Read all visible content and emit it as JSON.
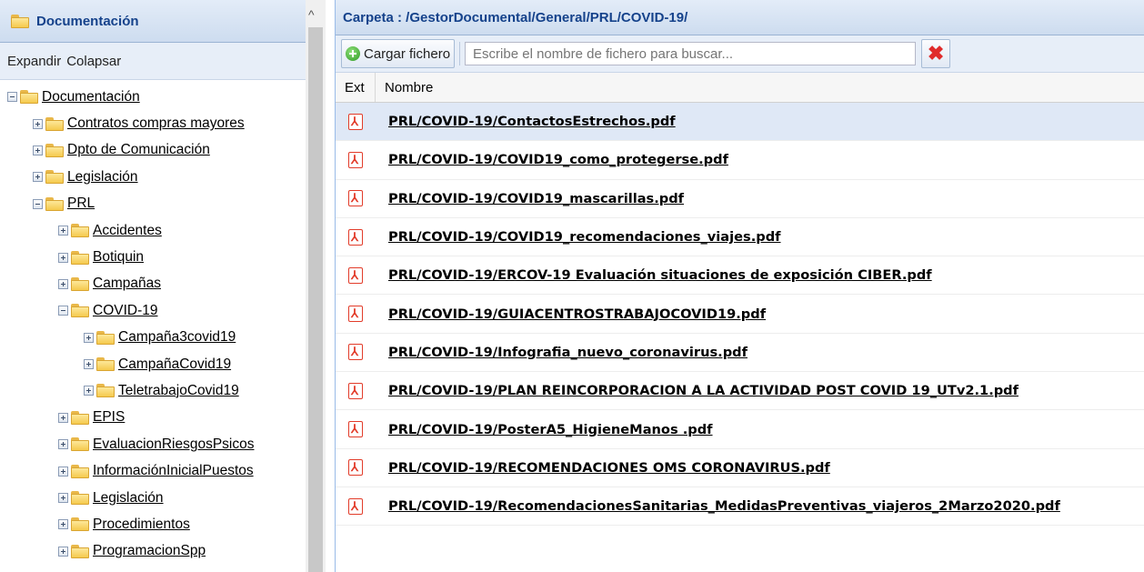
{
  "left_panel": {
    "title": "Documentación",
    "expand_label": "Expandir",
    "collapse_label": "Colapsar",
    "tree": [
      {
        "label": "Documentación",
        "level": 0,
        "expanded": true
      },
      {
        "label": "Contratos compras mayores",
        "level": 1,
        "expanded": false
      },
      {
        "label": "Dpto de Comunicación",
        "level": 1,
        "expanded": false
      },
      {
        "label": "Legislación",
        "level": 1,
        "expanded": false
      },
      {
        "label": "PRL",
        "level": 1,
        "expanded": true
      },
      {
        "label": "Accidentes",
        "level": 2,
        "expanded": false
      },
      {
        "label": "Botiquin",
        "level": 2,
        "expanded": false
      },
      {
        "label": "Campañas",
        "level": 2,
        "expanded": false
      },
      {
        "label": "COVID-19",
        "level": 2,
        "expanded": true
      },
      {
        "label": "Campaña3covid19",
        "level": 3,
        "expanded": false
      },
      {
        "label": "CampañaCovid19",
        "level": 3,
        "expanded": false
      },
      {
        "label": "TeletrabajoCovid19",
        "level": 3,
        "expanded": false
      },
      {
        "label": "EPIS",
        "level": 2,
        "expanded": false
      },
      {
        "label": "EvaluacionRiesgosPsicos",
        "level": 2,
        "expanded": false
      },
      {
        "label": "InformaciónInicialPuestos",
        "level": 2,
        "expanded": false
      },
      {
        "label": "Legislación",
        "level": 2,
        "expanded": false
      },
      {
        "label": "Procedimientos",
        "level": 2,
        "expanded": false
      },
      {
        "label": "ProgramacionSpp",
        "level": 2,
        "expanded": false
      }
    ]
  },
  "right_panel": {
    "title": "Carpeta : /GestorDocumental/General/PRL/COVID-19/",
    "upload_label": "Cargar fichero",
    "search_placeholder": "Escribe el nombre de fichero para buscar...",
    "columns": {
      "ext": "Ext",
      "name": "Nombre"
    },
    "files": [
      "PRL/COVID-19/ContactosEstrechos.pdf",
      "PRL/COVID-19/COVID19_como_protegerse.pdf",
      "PRL/COVID-19/COVID19_mascarillas.pdf",
      "PRL/COVID-19/COVID19_recomendaciones_viajes.pdf",
      "PRL/COVID-19/ERCOV-19 Evaluación situaciones de exposición CIBER.pdf",
      "PRL/COVID-19/GUIACENTROSTRABAJOCOVID19.pdf",
      "PRL/COVID-19/Infografia_nuevo_coronavirus.pdf",
      "PRL/COVID-19/PLAN REINCORPORACION A LA ACTIVIDAD POST COVID 19_UTv2.1.pdf",
      "PRL/COVID-19/PosterA5_HigieneManos .pdf",
      "PRL/COVID-19/RECOMENDACIONES OMS CORONAVIRUS.pdf",
      "PRL/COVID-19/RecomendacionesSanitarias_MedidasPreventivas_viajeros_2Marzo2020.pdf"
    ],
    "selected_index": 0
  },
  "colors": {
    "header_text": "#15428b",
    "selection": "#dfe8f6",
    "pdf_red": "#e23c2a"
  }
}
